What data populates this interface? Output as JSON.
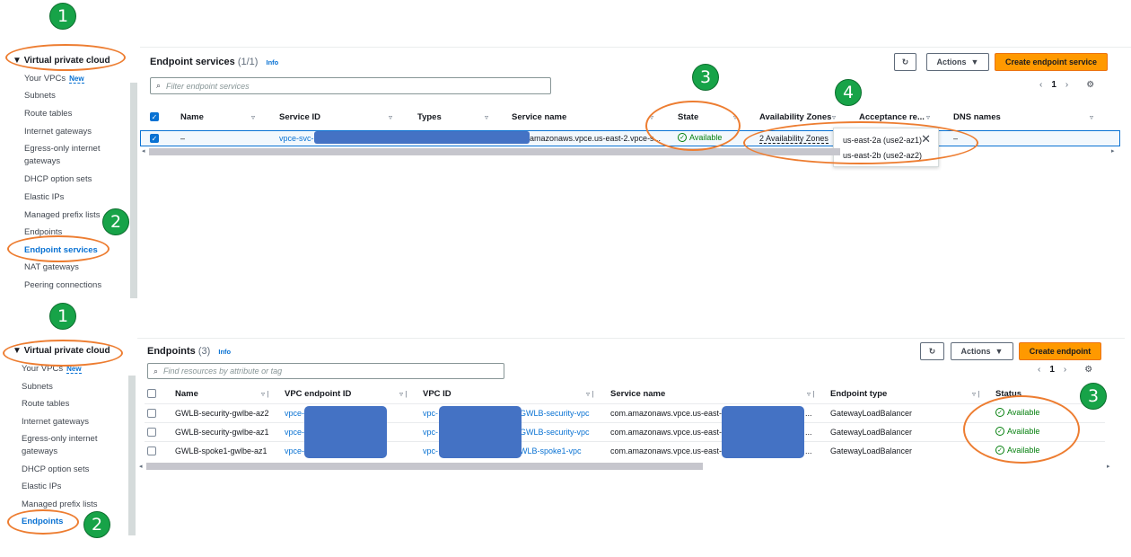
{
  "annotations": {
    "top": {
      "sidebar_header": "1",
      "sidebar_item": "2",
      "state": "3",
      "zones": "4"
    },
    "bottom": {
      "sidebar_header": "1",
      "sidebar_item": "2",
      "status": "3"
    }
  },
  "top": {
    "sidebar": {
      "header": "Virtual private cloud",
      "items": [
        "Your VPCs",
        "Subnets",
        "Route tables",
        "Internet gateways",
        "Egress-only internet",
        "gateways",
        "DHCP option sets",
        "Elastic IPs",
        "Managed prefix lists",
        "Endpoints",
        "Endpoint services",
        "NAT gateways",
        "Peering connections"
      ],
      "new_badge": "New"
    },
    "panel": {
      "title": "Endpoint services",
      "count": "(1/1)",
      "info": "Info",
      "actions": "Actions",
      "create": "Create endpoint service",
      "search_placeholder": "Filter endpoint services",
      "page": "1",
      "columns": [
        "Name",
        "Service ID",
        "Types",
        "Service name",
        "State",
        "Availability Zones",
        "Acceptance re...",
        "DNS names"
      ],
      "row": {
        "name": "–",
        "service_id": "vpce-svc-",
        "service_name": "amazonaws.vpce.us-east-2.vpce-s...",
        "state": "Available",
        "zones": "2 Availability Zones",
        "acceptance": "–"
      },
      "popover": [
        "us-east-2a (use2-az1)",
        "us-east-2b (use2-az2)"
      ]
    }
  },
  "bottom": {
    "sidebar": {
      "header": "Virtual private cloud",
      "items": [
        "Your VPCs",
        "Subnets",
        "Route tables",
        "Internet gateways",
        "Egress-only internet",
        "gateways",
        "DHCP option sets",
        "Elastic IPs",
        "Managed prefix lists",
        "Endpoints"
      ],
      "new_badge": "New"
    },
    "panel": {
      "title": "Endpoints",
      "count": "(3)",
      "info": "Info",
      "actions": "Actions",
      "create": "Create endpoint",
      "search_placeholder": "Find resources by attribute or tag",
      "page": "1",
      "columns": [
        "Name",
        "VPC endpoint ID",
        "VPC ID",
        "Service name",
        "Endpoint type",
        "Status"
      ],
      "rows": [
        {
          "name": "GWLB-security-gwlbe-az2",
          "endpoint_id": "vpce-",
          "vpc_prefix": "vpc-",
          "vpc_name": "GWLB-security-vpc",
          "service": "com.amazonaws.vpce.us-east-2.",
          "service_end": "...",
          "type": "GatewayLoadBalancer",
          "status": "Available"
        },
        {
          "name": "GWLB-security-gwlbe-az1",
          "endpoint_id": "vpce-",
          "vpc_prefix": "vpc-",
          "vpc_name": "GWLB-security-vpc",
          "service": "com.amazonaws.vpce.us-east-2.",
          "service_end": "...",
          "type": "GatewayLoadBalancer",
          "status": "Available"
        },
        {
          "name": "GWLB-spoke1-gwlbe-az1",
          "endpoint_id": "vpce-",
          "vpc_prefix": "vpc-",
          "vpc_name": "WLB-spoke1-vpc",
          "service": "com.amazonaws.vpce.us-east-2.",
          "service_end": "...",
          "type": "GatewayLoadBalancer",
          "status": "Available"
        }
      ]
    }
  }
}
